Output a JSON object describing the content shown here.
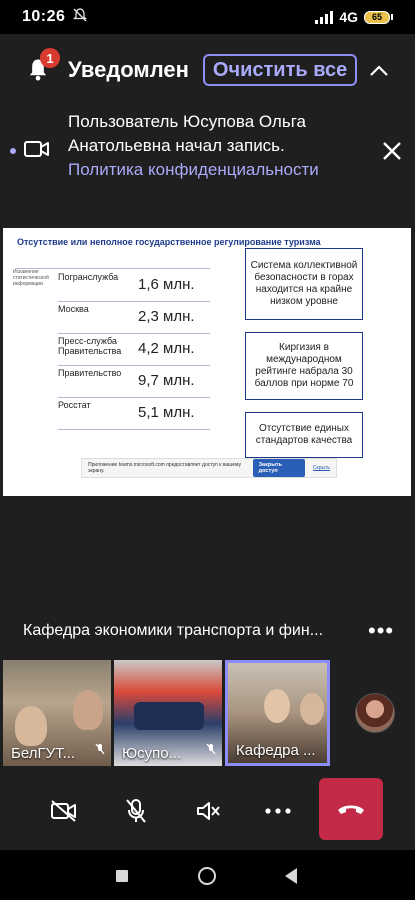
{
  "status_bar": {
    "time": "10:26",
    "network": "4G",
    "battery_label": "65"
  },
  "notifications": {
    "title": "Уведомлен",
    "badge_count": "1",
    "clear_all_label": "Очистить все",
    "item": {
      "line1": "Пользователь Юсупова Ольга",
      "line2": "Анатольевна начал запись.",
      "link": "Политика конфиденциальности"
    }
  },
  "slide": {
    "title": "Отсутствие или неполное государственное регулирование туризма",
    "source_note": "Искажение статистической информации",
    "rows": [
      {
        "label": "Погранслужба",
        "value": "1,6 млн."
      },
      {
        "label": "Москва",
        "value": "2,3 млн."
      },
      {
        "label": "Пресс-служба Правительства",
        "value": "4,2 млн."
      },
      {
        "label": "Правительство",
        "value": "9,7 млн."
      },
      {
        "label": "Росстат",
        "value": "5,1 млн."
      }
    ],
    "boxes": [
      "Система коллективной безопасности в горах находится на крайне низком уровне",
      "Киргизия в международном рейтинге набрала 30 баллов при норме 70",
      "Отсутствие единых стандартов качества"
    ],
    "share_bar": {
      "text": "Приложение teams.microsoft.com предоставляет доступ к вашему экрану.",
      "stop_label": "Закрыть доступ",
      "hide_label": "Скрыть"
    }
  },
  "meeting": {
    "title": "Кафедра экономики транспорта и фин...",
    "more_label": "•••"
  },
  "participants": [
    {
      "name": "БелГУТ..."
    },
    {
      "name": "Юсупо..."
    },
    {
      "name": "Кафедра ..."
    }
  ],
  "colors": {
    "accent": "#a9aaf9",
    "hangup": "#c22a47",
    "background": "#1f1f1f",
    "badge": "#d93b30"
  },
  "icons": {
    "camera_off": "video-off-icon",
    "mic_off": "mic-off-icon",
    "speaker_off": "speaker-off-icon",
    "more": "more-icon",
    "hangup": "phone-hangup-icon"
  }
}
